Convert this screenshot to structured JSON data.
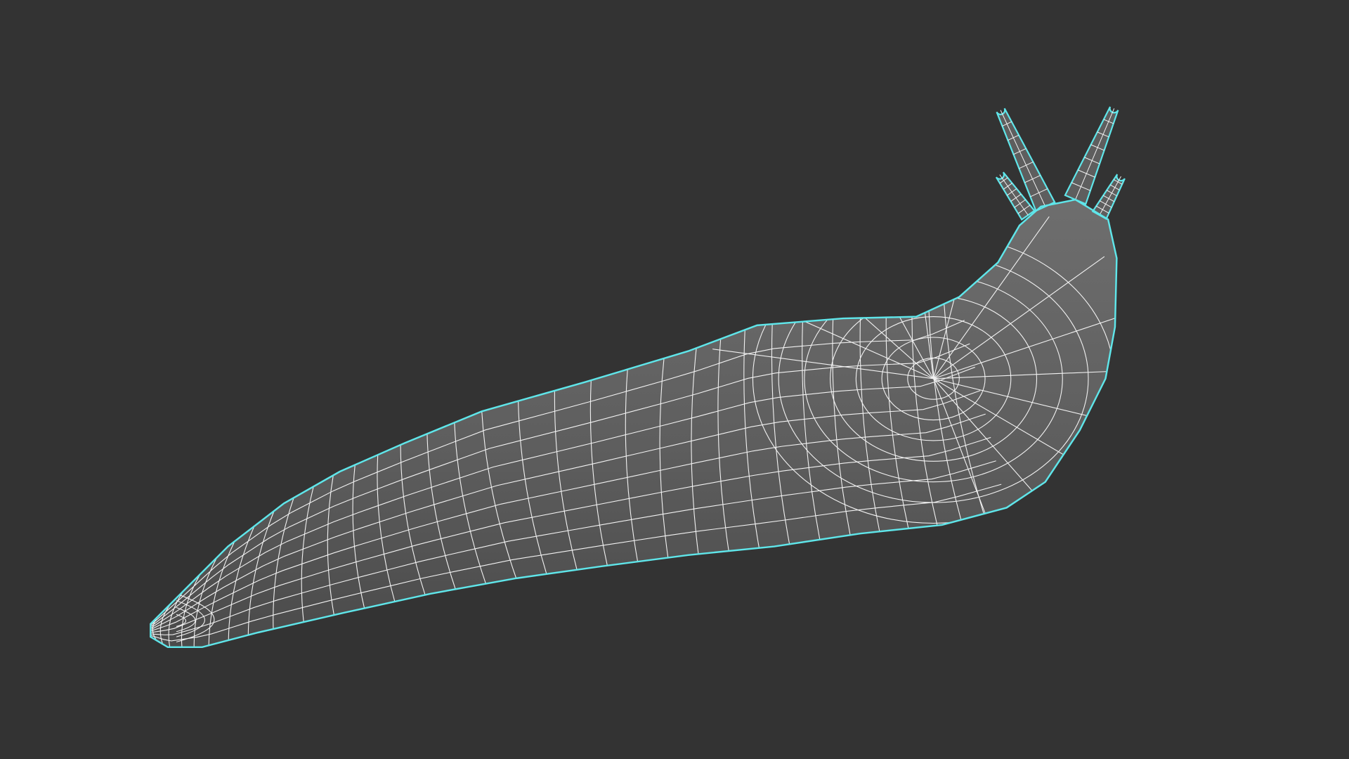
{
  "viewport": {
    "background_color": "#333333",
    "object": {
      "kind": "polygon-mesh-slug",
      "display_mode": "wireframe-on-shaded",
      "selected": true,
      "colors": {
        "surface_light": "#6e6e6e",
        "surface_mid": "#5e5e5e",
        "surface_dark": "#4a4a4a",
        "wireframe": "#f2f2f2",
        "selection_outline": "#5fe6ea"
      }
    }
  }
}
